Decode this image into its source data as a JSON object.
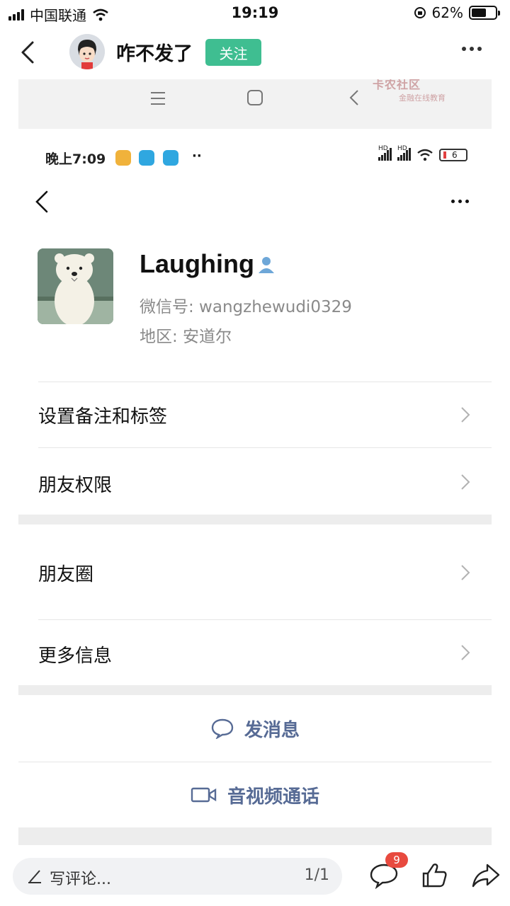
{
  "status_bar": {
    "carrier": "中国联通",
    "time": "19:19",
    "battery": "62%",
    "battery_level": 0.62
  },
  "header": {
    "username": "咋不发了",
    "follow_label": "关注"
  },
  "screenshot": {
    "watermark": {
      "line1": "卡农社区",
      "line2": "金融在线教育"
    },
    "android_status": {
      "time": "晚上7:09",
      "dots": "··",
      "hd1": "HD",
      "hd2": "HD",
      "battery": "6"
    },
    "profile": {
      "name": "Laughing",
      "wechat_id": "微信号: wangzhewudi0329",
      "region": "地区: 安道尔"
    },
    "rows": [
      {
        "label": "设置备注和标签"
      },
      {
        "label": "朋友权限"
      },
      {
        "label": "朋友圈"
      },
      {
        "label": "更多信息"
      }
    ],
    "actions": {
      "message": "发消息",
      "call": "音视频通话"
    }
  },
  "bottom_bar": {
    "placeholder": "写评论...",
    "page": "1/1",
    "comment_count": "9"
  }
}
